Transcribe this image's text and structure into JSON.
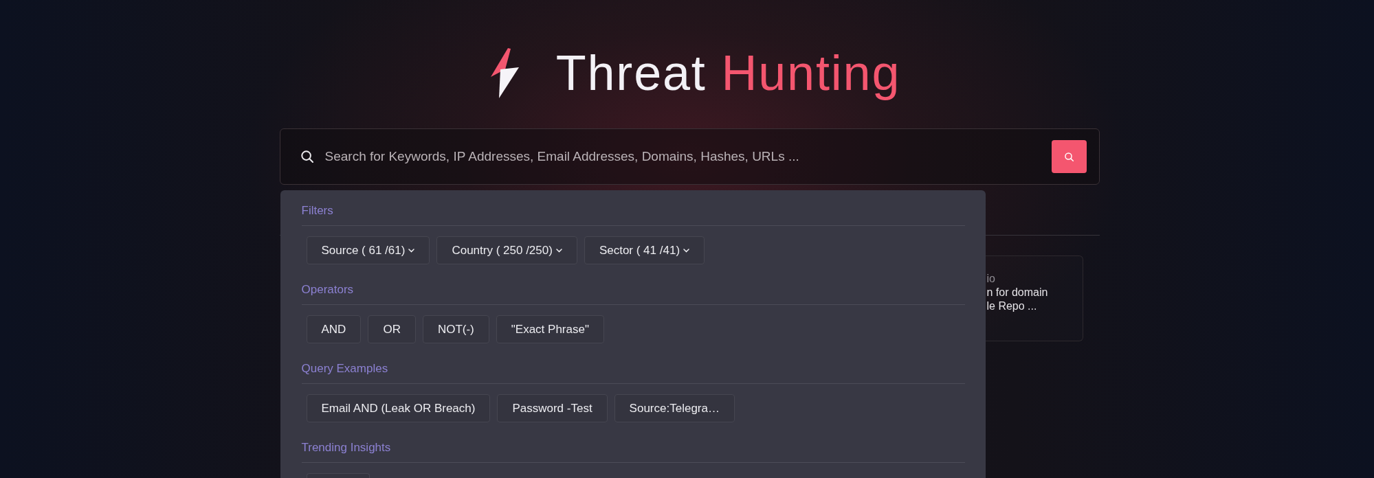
{
  "title": {
    "lead": "Threat",
    "accent": "Hunting"
  },
  "search": {
    "placeholder": "Search for Keywords, IP Addresses, Email Addresses, Domains, Hashes, URLs ..."
  },
  "suggestions_panel": {
    "sections": [
      {
        "heading": "Filters",
        "chips": [
          {
            "label": "Source ( 61 /61)",
            "kind": "dropdown"
          },
          {
            "label": "Country ( 250 /250)",
            "kind": "dropdown"
          },
          {
            "label": "Sector ( 41 /41)",
            "kind": "dropdown"
          }
        ]
      },
      {
        "heading": "Operators",
        "chips": [
          {
            "label": "AND",
            "kind": "option"
          },
          {
            "label": "OR",
            "kind": "option"
          },
          {
            "label": "NOT(-)",
            "kind": "option"
          },
          {
            "label": "\"Exact Phrase\"",
            "kind": "option"
          }
        ]
      },
      {
        "heading": "Query Examples",
        "chips": [
          {
            "label": "Email AND (Leak OR Breach)",
            "kind": "option"
          },
          {
            "label": "Password -Test",
            "kind": "option"
          },
          {
            "label": "Source:Telegra…",
            "kind": "option"
          }
        ]
      },
      {
        "heading": "Trending Insights",
        "chips": [
          {
            "kind": "clipped"
          }
        ]
      }
    ]
  },
  "result_card": {
    "label": "io",
    "lines": [
      "n for domain",
      "le Repo ..."
    ]
  }
}
